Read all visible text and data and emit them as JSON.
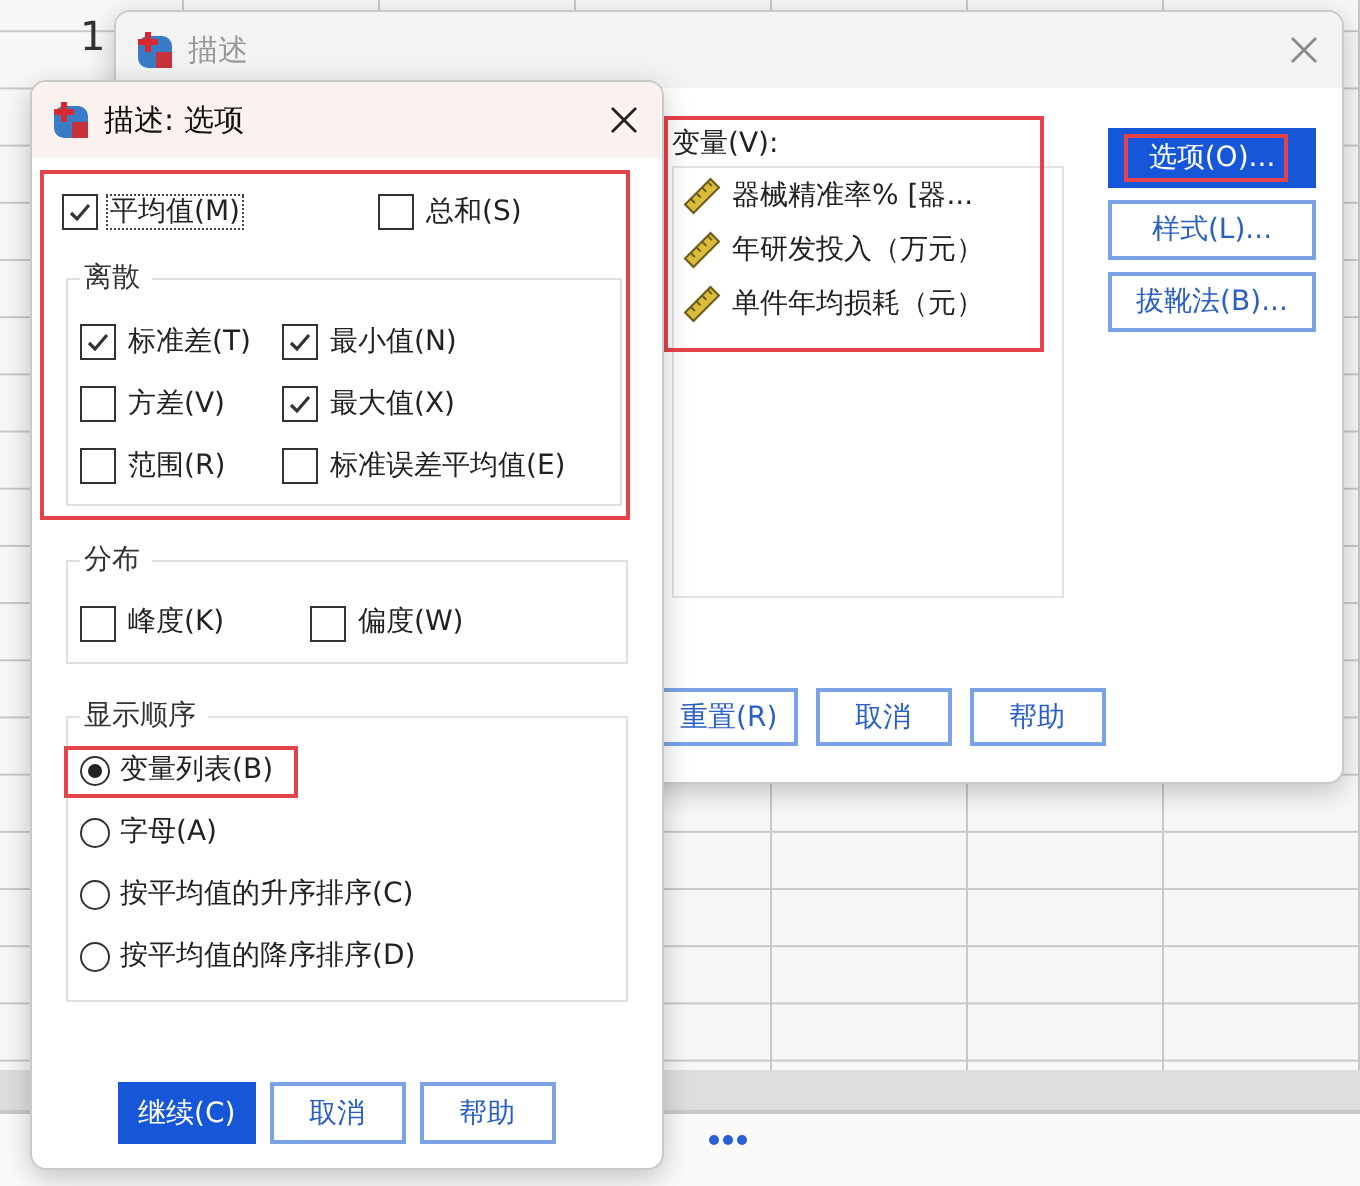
{
  "background": {
    "row_label": "1"
  },
  "main_dialog": {
    "title": "描述",
    "active": false,
    "variables": {
      "label": "变量(V):",
      "highlighted": true,
      "items": [
        "器械精准率% [器...",
        "年研发投入（万元）",
        "单件年均损耗（元）"
      ]
    },
    "side_buttons": [
      {
        "label": "选项(O)...",
        "primary": true,
        "highlighted": true
      },
      {
        "label": "样式(L)...",
        "primary": false,
        "highlighted": false
      },
      {
        "label": "拔靴法(B)...",
        "primary": false,
        "highlighted": false
      }
    ],
    "bottom_buttons": [
      {
        "label": "重置(R)",
        "primary": false
      },
      {
        "label": "取消",
        "primary": false
      },
      {
        "label": "帮助",
        "primary": false
      }
    ]
  },
  "options_dialog": {
    "title": "描述: 选项",
    "active": true,
    "top_group": {
      "highlighted": true,
      "items": [
        {
          "label": "平均值(M)",
          "checked": true,
          "focused": true
        },
        {
          "label": "总和(S)",
          "checked": false,
          "focused": false
        }
      ]
    },
    "dispersion": {
      "title": "离散",
      "items": [
        {
          "label": "标准差(T)",
          "checked": true
        },
        {
          "label": "最小值(N)",
          "checked": true
        },
        {
          "label": "方差(V)",
          "checked": false
        },
        {
          "label": "最大值(X)",
          "checked": true
        },
        {
          "label": "范围(R)",
          "checked": false
        },
        {
          "label": "标准误差平均值(E)",
          "checked": false
        }
      ]
    },
    "distribution": {
      "title": "分布",
      "items": [
        {
          "label": "峰度(K)",
          "checked": false
        },
        {
          "label": "偏度(W)",
          "checked": false
        }
      ]
    },
    "display_order": {
      "title": "显示顺序",
      "options": [
        {
          "label": "变量列表(B)",
          "selected": true,
          "highlighted": true
        },
        {
          "label": "字母(A)",
          "selected": false,
          "highlighted": false
        },
        {
          "label": "按平均值的升序排序(C)",
          "selected": false,
          "highlighted": false
        },
        {
          "label": "按平均值的降序排序(D)",
          "selected": false,
          "highlighted": false
        }
      ]
    },
    "buttons": [
      {
        "label": "继续(C)",
        "primary": true
      },
      {
        "label": "取消",
        "primary": false
      },
      {
        "label": "帮助",
        "primary": false
      }
    ]
  }
}
